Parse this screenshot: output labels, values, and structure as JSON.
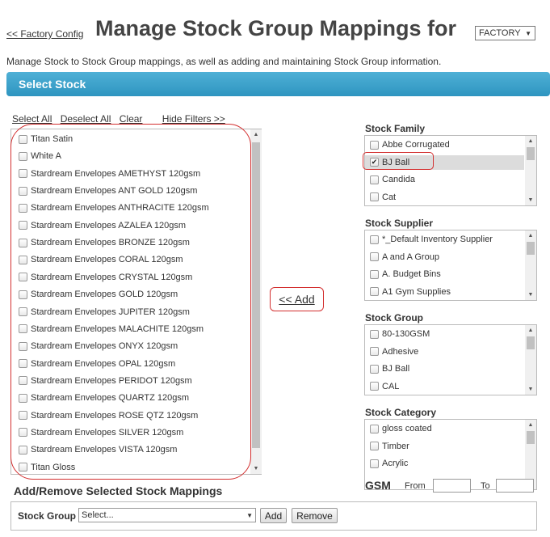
{
  "header": {
    "back_link": "<< Factory Config",
    "title": "Manage Stock Group Mappings for",
    "factory_selected": "FACTORY",
    "subtitle": "Manage Stock to Stock Group mappings, as well as adding and maintaining Stock Group information."
  },
  "select_stock_bar": "Select Stock",
  "filter_links": {
    "select_all": "Select All",
    "deselect_all": "Deselect All",
    "clear": "Clear",
    "hide_filters": "Hide Filters >>"
  },
  "stock_list": [
    {
      "label": "Titan Satin",
      "checked": false
    },
    {
      "label": "White A",
      "checked": false
    },
    {
      "label": "Stardream Envelopes AMETHYST 120gsm",
      "checked": false
    },
    {
      "label": "Stardream Envelopes ANT GOLD 120gsm",
      "checked": false
    },
    {
      "label": "Stardream Envelopes ANTHRACITE 120gsm",
      "checked": false
    },
    {
      "label": "Stardream Envelopes AZALEA 120gsm",
      "checked": false
    },
    {
      "label": "Stardream Envelopes BRONZE 120gsm",
      "checked": false
    },
    {
      "label": "Stardream Envelopes CORAL 120gsm",
      "checked": false
    },
    {
      "label": "Stardream Envelopes CRYSTAL 120gsm",
      "checked": false
    },
    {
      "label": "Stardream Envelopes GOLD 120gsm",
      "checked": false
    },
    {
      "label": "Stardream Envelopes JUPITER 120gsm",
      "checked": false
    },
    {
      "label": "Stardream Envelopes MALACHITE 120gsm",
      "checked": false
    },
    {
      "label": "Stardream Envelopes ONYX 120gsm",
      "checked": false
    },
    {
      "label": "Stardream Envelopes OPAL 120gsm",
      "checked": false
    },
    {
      "label": "Stardream Envelopes PERIDOT 120gsm",
      "checked": false
    },
    {
      "label": "Stardream Envelopes QUARTZ 120gsm",
      "checked": false
    },
    {
      "label": "Stardream Envelopes ROSE QTZ 120gsm",
      "checked": false
    },
    {
      "label": "Stardream Envelopes SILVER 120gsm",
      "checked": false
    },
    {
      "label": "Stardream Envelopes VISTA 120gsm",
      "checked": false
    },
    {
      "label": "Titan Gloss",
      "checked": false
    }
  ],
  "add_button": "<< Add",
  "panels": {
    "stock_family": {
      "title": "Stock Family",
      "items": [
        {
          "label": "Abbe Corrugated",
          "checked": false
        },
        {
          "label": "BJ Ball",
          "checked": true
        },
        {
          "label": "Candida",
          "checked": false
        },
        {
          "label": "Cat",
          "checked": false
        }
      ]
    },
    "stock_supplier": {
      "title": "Stock Supplier",
      "items": [
        {
          "label": "*_Default Inventory Supplier",
          "checked": false
        },
        {
          "label": "A and A Group",
          "checked": false
        },
        {
          "label": "A. Budget Bins",
          "checked": false
        },
        {
          "label": "A1 Gym Supplies",
          "checked": false
        }
      ]
    },
    "stock_group": {
      "title": "Stock Group",
      "items": [
        {
          "label": "80-130GSM",
          "checked": false
        },
        {
          "label": "Adhesive",
          "checked": false
        },
        {
          "label": "BJ Ball",
          "checked": false
        },
        {
          "label": "CAL",
          "checked": false
        }
      ]
    },
    "stock_category": {
      "title": "Stock Category",
      "items": [
        {
          "label": "gloss coated",
          "checked": false
        },
        {
          "label": "Timber",
          "checked": false
        },
        {
          "label": "Acrylic",
          "checked": false
        }
      ]
    }
  },
  "gsm": {
    "label": "GSM",
    "from_label": "From",
    "from_value": "",
    "to_label": "To",
    "to_value": ""
  },
  "add_remove": {
    "title": "Add/Remove Selected Stock Mappings",
    "stock_group_label": "Stock Group",
    "stock_group_selected": "Select...",
    "add_label": "Add",
    "remove_label": "Remove"
  },
  "colors": {
    "accent_bar": "#3aa3cf",
    "highlight_red": "#d32f2f"
  }
}
